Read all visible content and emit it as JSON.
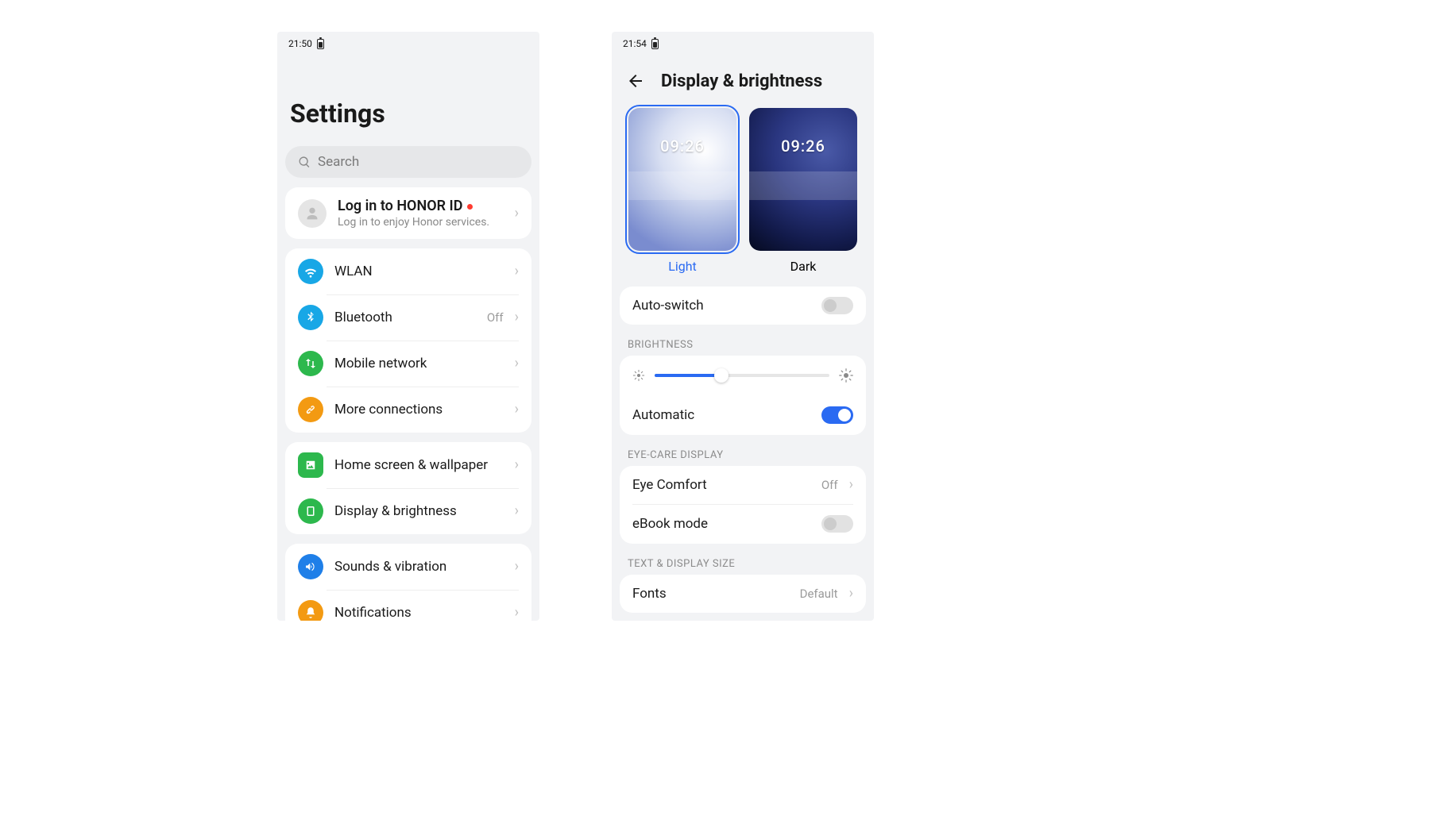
{
  "left": {
    "status_time": "21:50",
    "title": "Settings",
    "search_placeholder": "Search",
    "honor": {
      "title": "Log in to HONOR ID",
      "sub": "Log in to enjoy Honor services."
    },
    "g1": {
      "wlan": "WLAN",
      "bluetooth": "Bluetooth",
      "bluetooth_value": "Off",
      "mobile": "Mobile network",
      "more": "More connections"
    },
    "g2": {
      "home": "Home screen & wallpaper",
      "display": "Display & brightness"
    },
    "g3": {
      "sounds": "Sounds & vibration",
      "notif": "Notifications"
    }
  },
  "right": {
    "status_time": "21:54",
    "title": "Display & brightness",
    "thumb_time": "09:26",
    "theme_light": "Light",
    "theme_dark": "Dark",
    "auto_switch": "Auto-switch",
    "sec_brightness": "BRIGHTNESS",
    "brightness_pct": 38,
    "automatic": "Automatic",
    "sec_eyecare": "EYE-CARE DISPLAY",
    "eye_comfort": "Eye Comfort",
    "eye_comfort_value": "Off",
    "ebook": "eBook mode",
    "sec_text": "TEXT & DISPLAY SIZE",
    "fonts": "Fonts",
    "fonts_value": "Default"
  },
  "colors": {
    "wifi": "#18a7e6",
    "bt": "#18a7e6",
    "mobile": "#2db84d",
    "link": "#f39a12",
    "home": "#2db84d",
    "display": "#2db84d",
    "sound": "#1f7fe8",
    "bell": "#f39a12"
  }
}
